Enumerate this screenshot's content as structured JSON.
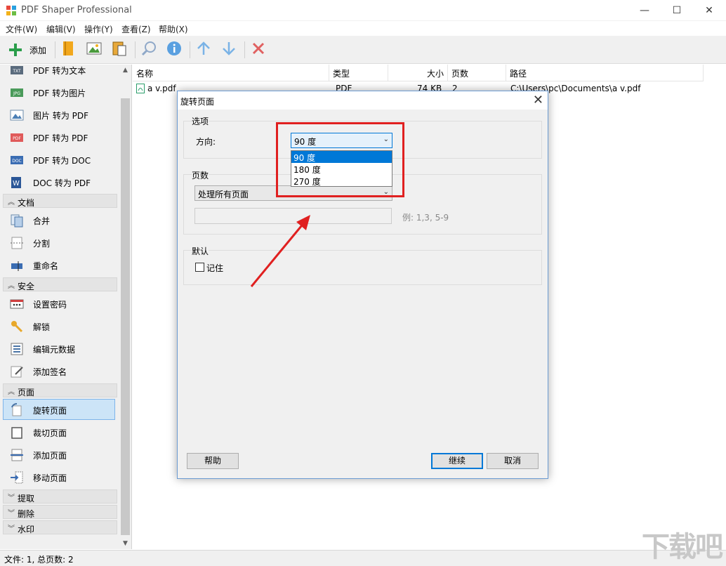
{
  "window": {
    "title": "PDF Shaper Professional",
    "minimize_glyph": "—",
    "maximize_glyph": "☐",
    "close_glyph": "✕"
  },
  "menu": [
    "文件(W)",
    "编辑(V)",
    "操作(Y)",
    "查看(Z)",
    "帮助(X)"
  ],
  "toolbar": {
    "add_label": "添加",
    "icons": [
      "plus-icon",
      "folder-icon",
      "image-icon",
      "paste-icon",
      "search-icon",
      "info-icon",
      "arrow-up-icon",
      "arrow-down-icon",
      "delete-icon"
    ]
  },
  "sidebar": {
    "convert_items": [
      {
        "label": "PDF 转为文本",
        "icon": "txt-icon"
      },
      {
        "label": "PDF 转为图片",
        "icon": "jpg-icon"
      },
      {
        "label": "图片 转为 PDF",
        "icon": "image-icon"
      },
      {
        "label": "PDF 转为 PDF",
        "icon": "pdf-icon"
      },
      {
        "label": "PDF 转为 DOC",
        "icon": "doc-icon"
      },
      {
        "label": "DOC 转为 PDF",
        "icon": "word-icon"
      }
    ],
    "group_document": "文档",
    "document_items": [
      {
        "label": "合并",
        "icon": "merge-icon"
      },
      {
        "label": "分割",
        "icon": "split-icon"
      },
      {
        "label": "重命名",
        "icon": "rename-icon"
      }
    ],
    "group_security": "安全",
    "security_items": [
      {
        "label": "设置密码",
        "icon": "password-icon"
      },
      {
        "label": "解锁",
        "icon": "key-icon"
      },
      {
        "label": "编辑元数据",
        "icon": "metadata-icon"
      },
      {
        "label": "添加签名",
        "icon": "signature-icon"
      }
    ],
    "group_pages": "页面",
    "page_items": [
      {
        "label": "旋转页面",
        "icon": "rotate-icon",
        "active": true
      },
      {
        "label": "裁切页面",
        "icon": "crop-icon"
      },
      {
        "label": "添加页面",
        "icon": "add-page-icon"
      },
      {
        "label": "移动页面",
        "icon": "move-page-icon"
      }
    ],
    "group_extract": "提取",
    "group_delete": "删除",
    "group_watermark": "水印"
  },
  "filelist": {
    "columns": [
      "名称",
      "类型",
      "大小",
      "页数",
      "路径"
    ],
    "rows": [
      {
        "name": "a v.pdf",
        "type": "PDF",
        "size": "74 KB",
        "pages": "2",
        "path": "C:\\Users\\pc\\Documents\\a v.pdf"
      }
    ]
  },
  "status": {
    "text": "文件: 1, 总页数: 2"
  },
  "watermark_text": "下载吧",
  "dialog": {
    "title": "旋转页面",
    "options_group": "选项",
    "direction_label": "方向:",
    "direction_value": "90 度",
    "direction_options": [
      "90 度",
      "180 度",
      "270 度"
    ],
    "pages_group": "页数",
    "pages_value": "处理所有页面",
    "pages_hint": "例: 1,3, 5-9",
    "default_group": "默认",
    "remember_label": "记住",
    "help_button": "帮助",
    "continue_button": "继续",
    "cancel_button": "取消"
  },
  "colors": {
    "accent": "#0078d7",
    "annotation": "#e02020",
    "sidebar_active": "#cce4f7"
  }
}
